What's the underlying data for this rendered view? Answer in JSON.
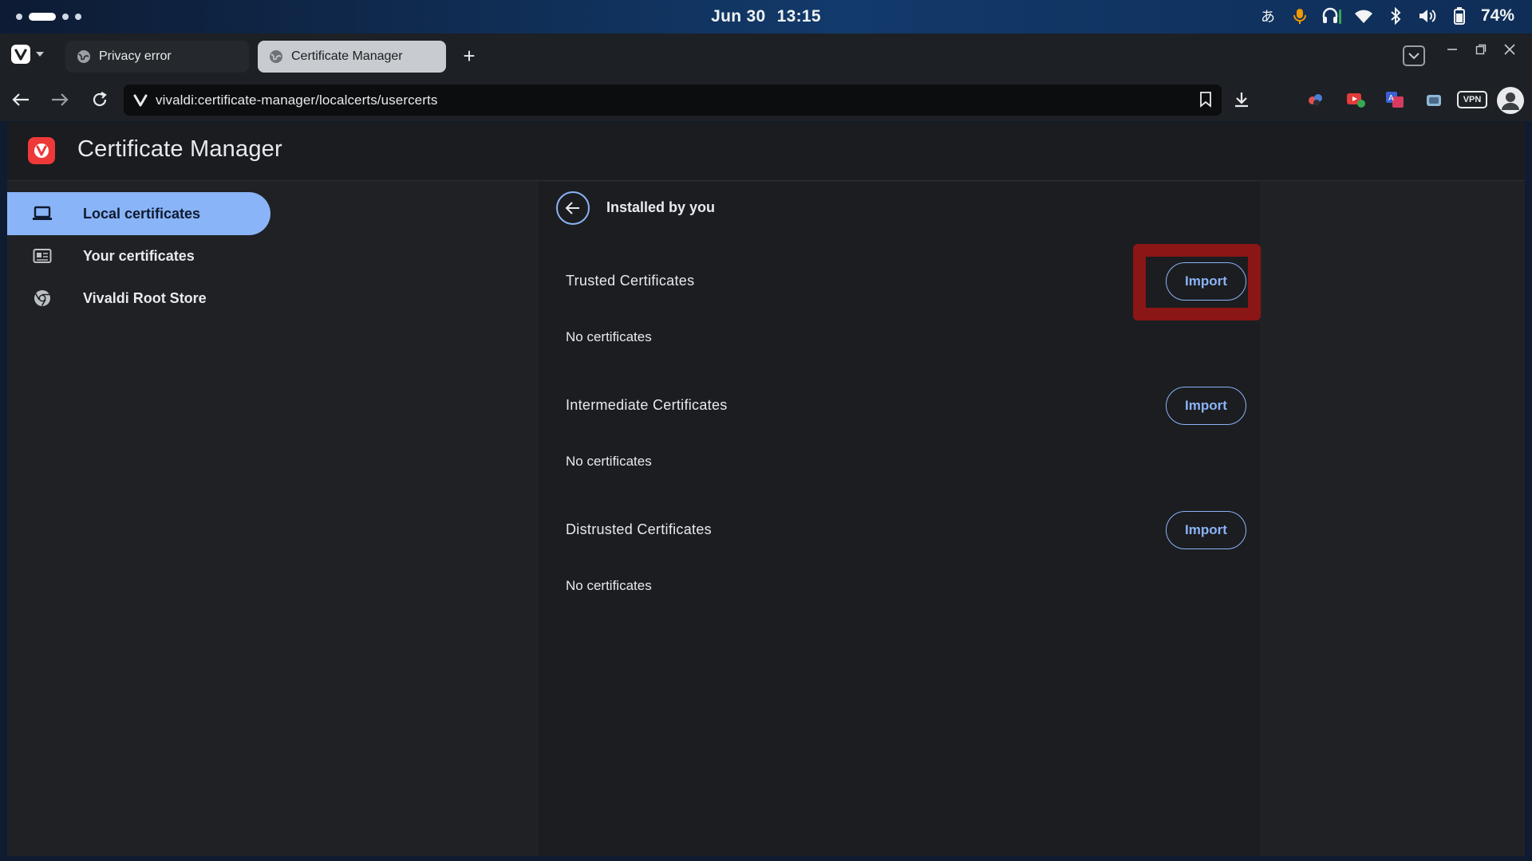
{
  "status_bar": {
    "date": "Jun 30",
    "time": "13:15",
    "battery": "74%",
    "icons": [
      "ime-icon",
      "microphone-icon",
      "headset-icon",
      "wifi-icon",
      "bluetooth-icon",
      "volume-icon",
      "battery-icon"
    ]
  },
  "tabs": [
    {
      "label": "Privacy error",
      "active": false
    },
    {
      "label": "Certificate Manager",
      "active": true
    }
  ],
  "address_bar": {
    "url": "vivaldi:certificate-manager/localcerts/usercerts"
  },
  "toolbar": {
    "vpn_label": "VPN"
  },
  "app": {
    "title": "Certificate Manager",
    "brand_color": "#ef3939",
    "accent_color": "#8ab4f8"
  },
  "sidebar": {
    "items": [
      {
        "label": "Local certificates",
        "icon": "laptop-icon",
        "selected": true
      },
      {
        "label": "Your certificates",
        "icon": "id-card-icon",
        "selected": false
      },
      {
        "label": "Vivaldi Root Store",
        "icon": "chrome-store-icon",
        "selected": false
      }
    ]
  },
  "content": {
    "section_title": "Installed by you",
    "groups": [
      {
        "label": "Trusted Certificates",
        "button": "Import",
        "empty_text": "No certificates",
        "highlighted": true
      },
      {
        "label": "Intermediate Certificates",
        "button": "Import",
        "empty_text": "No certificates",
        "highlighted": false
      },
      {
        "label": "Distrusted Certificates",
        "button": "Import",
        "empty_text": "No certificates",
        "highlighted": false
      }
    ]
  }
}
